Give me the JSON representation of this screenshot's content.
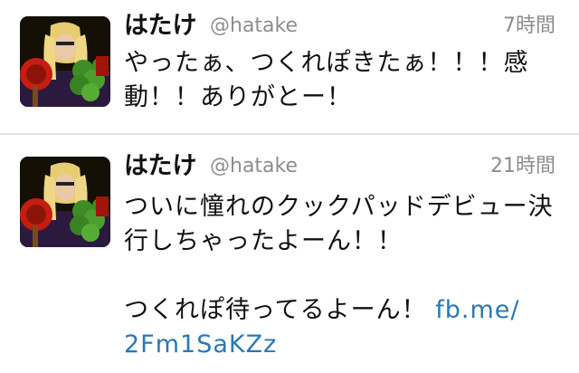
{
  "tweets": [
    {
      "name": "はたけ",
      "handle": "@hatake",
      "time": "7時間",
      "lines": [
        "やったぁ、つくれぽきたぁ！！！感",
        "動！！ありがとー！"
      ]
    },
    {
      "name": "はたけ",
      "handle": "@hatake",
      "time": "21時間",
      "lines": [
        "ついに憧れのクックパッドデビュー決",
        "行しちゃったよーん！！"
      ],
      "line3_text": "つくれぽ待ってるよーん！",
      "link_part1": "fb.me/",
      "link_part2": "2Fm1SaKZz"
    }
  ],
  "colors": {
    "link": "#2a78b4",
    "meta": "#8d8d8d",
    "divider": "#e1e1e1"
  }
}
